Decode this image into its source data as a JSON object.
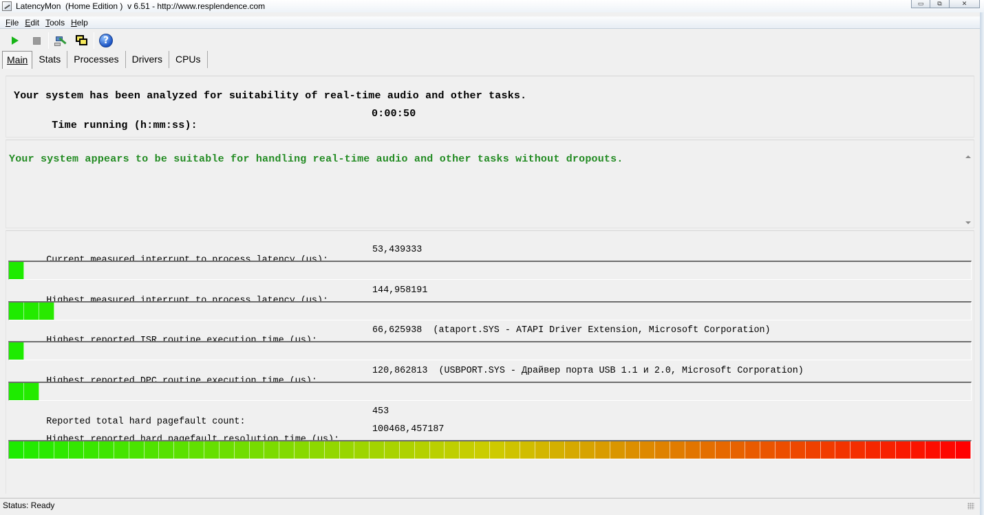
{
  "window": {
    "title": "LatencyMon  (Home Edition )  v 6.51 - http://www.resplendence.com",
    "controls": {
      "minimize": "▭",
      "restore": "⧉",
      "close": "✕"
    }
  },
  "menu": [
    {
      "first": "F",
      "rest": "ile"
    },
    {
      "first": "E",
      "rest": "dit"
    },
    {
      "first": "T",
      "rest": "ools"
    },
    {
      "first": "H",
      "rest": "elp"
    }
  ],
  "toolbar": {
    "icons": [
      "play-icon",
      "stop-icon",
      "tools-icon",
      "windows-icon",
      "help-icon"
    ],
    "help_glyph": "?"
  },
  "tabs": [
    {
      "label": "Main",
      "active": true
    },
    {
      "label": "Stats",
      "active": false
    },
    {
      "label": "Processes",
      "active": false
    },
    {
      "label": "Drivers",
      "active": false
    },
    {
      "label": "CPUs",
      "active": false
    }
  ],
  "summary": {
    "headline": "Your system has been analyzed for suitability of real-time audio and other tasks.",
    "time_label": "Time running (h:mm:ss):",
    "time_value": "0:00:50"
  },
  "verdict": {
    "text": "Your system appears to be suitable for handling real-time audio and other tasks without dropouts.",
    "color": "#228b22"
  },
  "metrics": [
    {
      "label": "Current measured interrupt to process latency (µs):",
      "value": "53,439333",
      "detail": "",
      "segments": 1
    },
    {
      "label": "Highest measured interrupt to process latency (µs):",
      "value": "144,958191",
      "detail": "",
      "segments": 3
    },
    {
      "label": "Highest reported ISR routine execution time (µs):",
      "value": "66,625938",
      "detail": "(ataport.SYS - ATAPI Driver Extension, Microsoft Corporation)",
      "segments": 1
    },
    {
      "label": "Highest reported DPC routine execution time (µs):",
      "value": "120,862813",
      "detail": "(USBPORT.SYS - Драйвер порта USB 1.1 и 2.0, Microsoft Corporation)",
      "segments": 2
    },
    {
      "label": "Reported total hard pagefault count:",
      "value": "453",
      "detail": "",
      "segments": null
    },
    {
      "label": "Highest reported hard pagefault resolution time (µs):",
      "value": "100468,457187",
      "detail": "",
      "segments": 64
    }
  ],
  "meter_total_segments": 64,
  "status": {
    "text": "Status: Ready"
  }
}
